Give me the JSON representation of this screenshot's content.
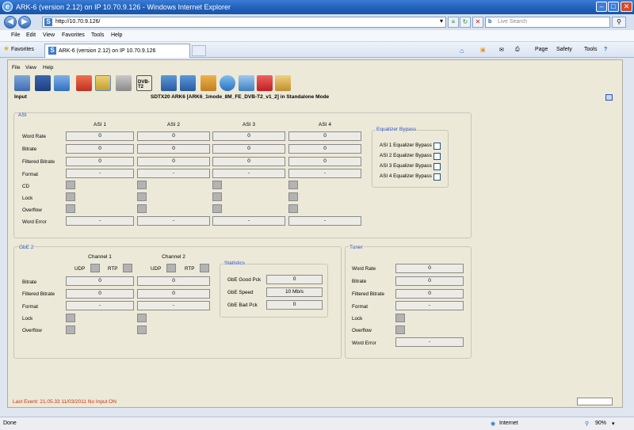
{
  "browser": {
    "window_title": "ARK-6 (version 2.12) on IP 10.70.9.126 - Windows Internet Explorer",
    "url": "http://10.70.9.126/",
    "search_placeholder": "Live Search",
    "menu": [
      "File",
      "Edit",
      "View",
      "Favorites",
      "Tools",
      "Help"
    ],
    "favorites_label": "Favorites",
    "tab_title": "ARK-6 (version 2.12) on IP 10.70.9.126",
    "commands": [
      "Page",
      "Safety",
      "Tools"
    ],
    "status_left": "Done",
    "zone": "Internet",
    "zoom": "90%"
  },
  "app": {
    "menu": [
      "File",
      "View",
      "Help"
    ],
    "toolbar_icons": [
      "network-icon",
      "save-icon",
      "open-folder-icon",
      "home-icon",
      "upload-icon",
      "device-icon",
      "dvb-t2-icon",
      "signal-icon",
      "signal-alt-icon",
      "transfer-icon",
      "web-icon",
      "reload-icon",
      "delete-icon",
      "edit-icon"
    ],
    "dvbt2_label": "DVB-T2",
    "page_label": "Input",
    "header": "SDTX20 ARK6 [ARK6_1mode_8M_FE_DVB-T2_v1_2] in Standalone Mode",
    "last_event": "Last Event: 21.05.33 11/03/2011 No Input ON"
  },
  "asi": {
    "title": "ASI",
    "columns": [
      "ASI 1",
      "ASI 2",
      "ASI 3",
      "ASI 4"
    ],
    "labels": {
      "word_rate": "Word Rate",
      "bitrate": "Bitrate",
      "filtered_bitrate": "Filtered Bitrate",
      "format": "Format",
      "cd": "CD",
      "lock": "Lock",
      "overflow": "Overflow",
      "word_error": "Word Error"
    },
    "word_rate": [
      "0",
      "0",
      "0",
      "0"
    ],
    "bitrate": [
      "0",
      "0",
      "0",
      "0"
    ],
    "filtered_bitrate": [
      "0",
      "0",
      "0",
      "0"
    ],
    "format": [
      "-",
      "-",
      "-",
      "-"
    ],
    "word_error": [
      "-",
      "-",
      "-",
      "-"
    ]
  },
  "equalizer": {
    "title": "Equalizer Bypass",
    "items": [
      "ASI 1 Equalizer Bypass",
      "ASI 2 Equalizer Bypass",
      "ASI 3 Equalizer Bypass",
      "ASI 4 Equalizer Bypass"
    ]
  },
  "gbe": {
    "title": "GbE 2",
    "channels": [
      "Channel 1",
      "Channel 2"
    ],
    "udp": "UDP",
    "rtp": "RTP",
    "labels": {
      "bitrate": "Bitrate",
      "filtered_bitrate": "Filtered Bitrate",
      "format": "Format",
      "lock": "Lock",
      "overflow": "Overflow"
    },
    "bitrate": [
      "0",
      "0"
    ],
    "filtered_bitrate": [
      "0",
      "0"
    ],
    "format": [
      "-",
      "-"
    ]
  },
  "statistics": {
    "title": "Statistics",
    "good_pck_label": "GbE Good Pck",
    "good_pck": "0",
    "speed_label": "GbE Speed",
    "speed": "10 Mb/s",
    "bad_pck_label": "GbE Bad Pck",
    "bad_pck": "0"
  },
  "tuner": {
    "title": "Tuner",
    "labels": {
      "word_rate": "Word Rate",
      "bitrate": "Bitrate",
      "filtered_bitrate": "Filtered Bitrate",
      "format": "Format",
      "lock": "Lock",
      "overflow": "Overflow",
      "word_error": "Word Error"
    },
    "word_rate": "0",
    "bitrate": "0",
    "filtered_bitrate": "0",
    "format": "-",
    "word_error": "-"
  }
}
